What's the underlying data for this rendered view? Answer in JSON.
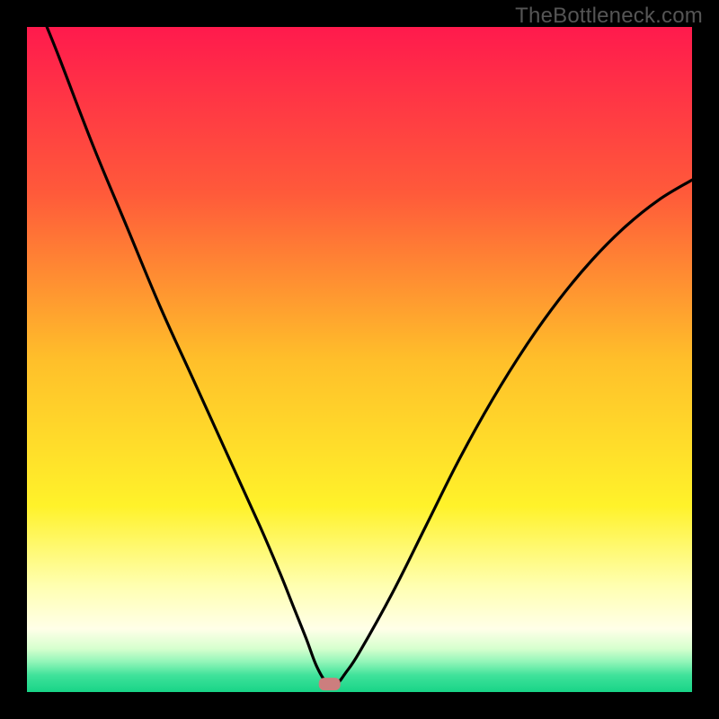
{
  "watermark": "TheBottleneck.com",
  "chart_data": {
    "type": "line",
    "title": "",
    "xlabel": "",
    "ylabel": "",
    "xlim": [
      0,
      100
    ],
    "ylim": [
      0,
      100
    ],
    "grid": false,
    "legend": false,
    "series": [
      {
        "name": "bottleneck-curve",
        "color": "#000000",
        "x": [
          3,
          5,
          10,
          15,
          20,
          25,
          30,
          35,
          38,
          40,
          42,
          43.5,
          45,
          46.5,
          48,
          50,
          55,
          60,
          65,
          70,
          75,
          80,
          85,
          90,
          95,
          100
        ],
        "values": [
          100,
          95,
          82,
          70,
          58,
          47,
          36,
          25,
          18,
          13,
          8,
          4,
          1.5,
          1.2,
          3,
          6,
          15,
          25,
          35,
          44,
          52,
          59,
          65,
          70,
          74,
          77
        ]
      }
    ],
    "marker": {
      "x": 45.5,
      "y": 1.2,
      "color": "#cc7e7e"
    },
    "background_gradient": {
      "stops": [
        {
          "offset": 0.0,
          "color": "#ff1a4d"
        },
        {
          "offset": 0.25,
          "color": "#ff5a3a"
        },
        {
          "offset": 0.5,
          "color": "#ffbf2a"
        },
        {
          "offset": 0.72,
          "color": "#fff22a"
        },
        {
          "offset": 0.84,
          "color": "#ffffb0"
        },
        {
          "offset": 0.905,
          "color": "#ffffe8"
        },
        {
          "offset": 0.935,
          "color": "#d6ffce"
        },
        {
          "offset": 0.955,
          "color": "#90f5b8"
        },
        {
          "offset": 0.975,
          "color": "#3fe29a"
        },
        {
          "offset": 1.0,
          "color": "#18d487"
        }
      ]
    },
    "frame": {
      "outer": 800,
      "border": 30
    }
  }
}
